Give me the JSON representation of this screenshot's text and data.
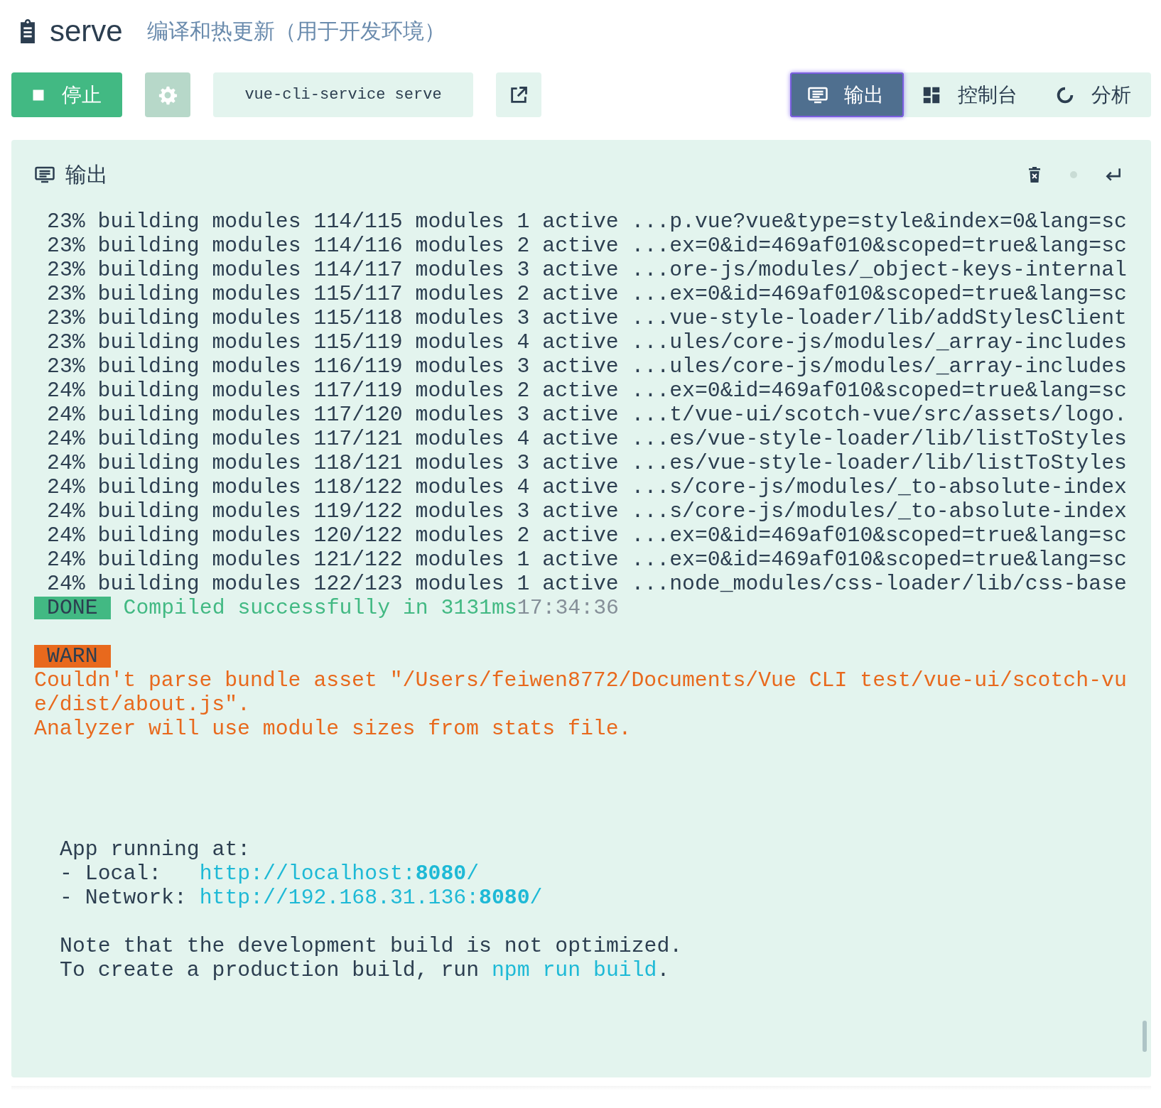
{
  "header": {
    "title": "serve",
    "description": "编译和热更新（用于开发环境）"
  },
  "toolbar": {
    "stop_button": "停止",
    "command": "vue-cli-service serve",
    "views": [
      {
        "label": "输出",
        "selected": true
      },
      {
        "label": "控制台",
        "selected": false
      },
      {
        "label": "分析",
        "selected": false
      }
    ]
  },
  "output_panel": {
    "title": "输出",
    "lines": [
      {
        "kind": "log",
        "text": "23% building modules 114/115 modules 1 active ...p.vue?vue&type=style&index=0&lang=sc"
      },
      {
        "kind": "log",
        "text": "23% building modules 114/116 modules 2 active ...ex=0&id=469af010&scoped=true&lang=sc"
      },
      {
        "kind": "log",
        "text": "23% building modules 114/117 modules 3 active ...ore-js/modules/_object-keys-internal"
      },
      {
        "kind": "log",
        "text": "23% building modules 115/117 modules 2 active ...ex=0&id=469af010&scoped=true&lang=sc"
      },
      {
        "kind": "log",
        "text": "23% building modules 115/118 modules 3 active ...vue-style-loader/lib/addStylesClient"
      },
      {
        "kind": "log",
        "text": "23% building modules 115/119 modules 4 active ...ules/core-js/modules/_array-includes"
      },
      {
        "kind": "log",
        "text": "23% building modules 116/119 modules 3 active ...ules/core-js/modules/_array-includes"
      },
      {
        "kind": "log",
        "text": "24% building modules 117/119 modules 2 active ...ex=0&id=469af010&scoped=true&lang=sc"
      },
      {
        "kind": "log",
        "text": "24% building modules 117/120 modules 3 active ...t/vue-ui/scotch-vue/src/assets/logo."
      },
      {
        "kind": "log",
        "text": "24% building modules 117/121 modules 4 active ...es/vue-style-loader/lib/listToStyles"
      },
      {
        "kind": "log",
        "text": "24% building modules 118/121 modules 3 active ...es/vue-style-loader/lib/listToStyles"
      },
      {
        "kind": "log",
        "text": "24% building modules 118/122 modules 4 active ...s/core-js/modules/_to-absolute-index"
      },
      {
        "kind": "log",
        "text": "24% building modules 119/122 modules 3 active ...s/core-js/modules/_to-absolute-index"
      },
      {
        "kind": "log",
        "text": "24% building modules 120/122 modules 2 active ...ex=0&id=469af010&scoped=true&lang=sc"
      },
      {
        "kind": "log",
        "text": "24% building modules 121/122 modules 1 active ...ex=0&id=469af010&scoped=true&lang=sc"
      },
      {
        "kind": "log",
        "text": "24% building modules 122/123 modules 1 active ...node_modules/css-loader/lib/css-base"
      },
      {
        "kind": "done",
        "badge": "DONE",
        "message": "Compiled successfully in 3131ms",
        "time": "17:34:36"
      },
      {
        "kind": "blank"
      },
      {
        "kind": "warn",
        "badge": "WARN"
      },
      {
        "kind": "warning",
        "text": "Couldn't parse bundle asset \"/Users/feiwen8772/Documents/Vue CLI test/vue-ui/scotch-vu"
      },
      {
        "kind": "warning",
        "text": "e/dist/about.js\"."
      },
      {
        "kind": "warning",
        "text": "Analyzer will use module sizes from stats file."
      },
      {
        "kind": "blank"
      },
      {
        "kind": "blank"
      },
      {
        "kind": "blank"
      },
      {
        "kind": "blank"
      },
      {
        "kind": "info",
        "text": "App running at:"
      },
      {
        "kind": "address",
        "label": "- Local:",
        "url": "http://localhost:**8080**/"
      },
      {
        "kind": "address",
        "label": "- Network:",
        "url": "http://192.168.31.136:**8080**/"
      },
      {
        "kind": "blank"
      },
      {
        "kind": "info",
        "text": "Note that the development build is not optimized."
      },
      {
        "kind": "command",
        "before": "To create a production build, run ",
        "command": "npm run build",
        "after": "."
      }
    ]
  }
}
